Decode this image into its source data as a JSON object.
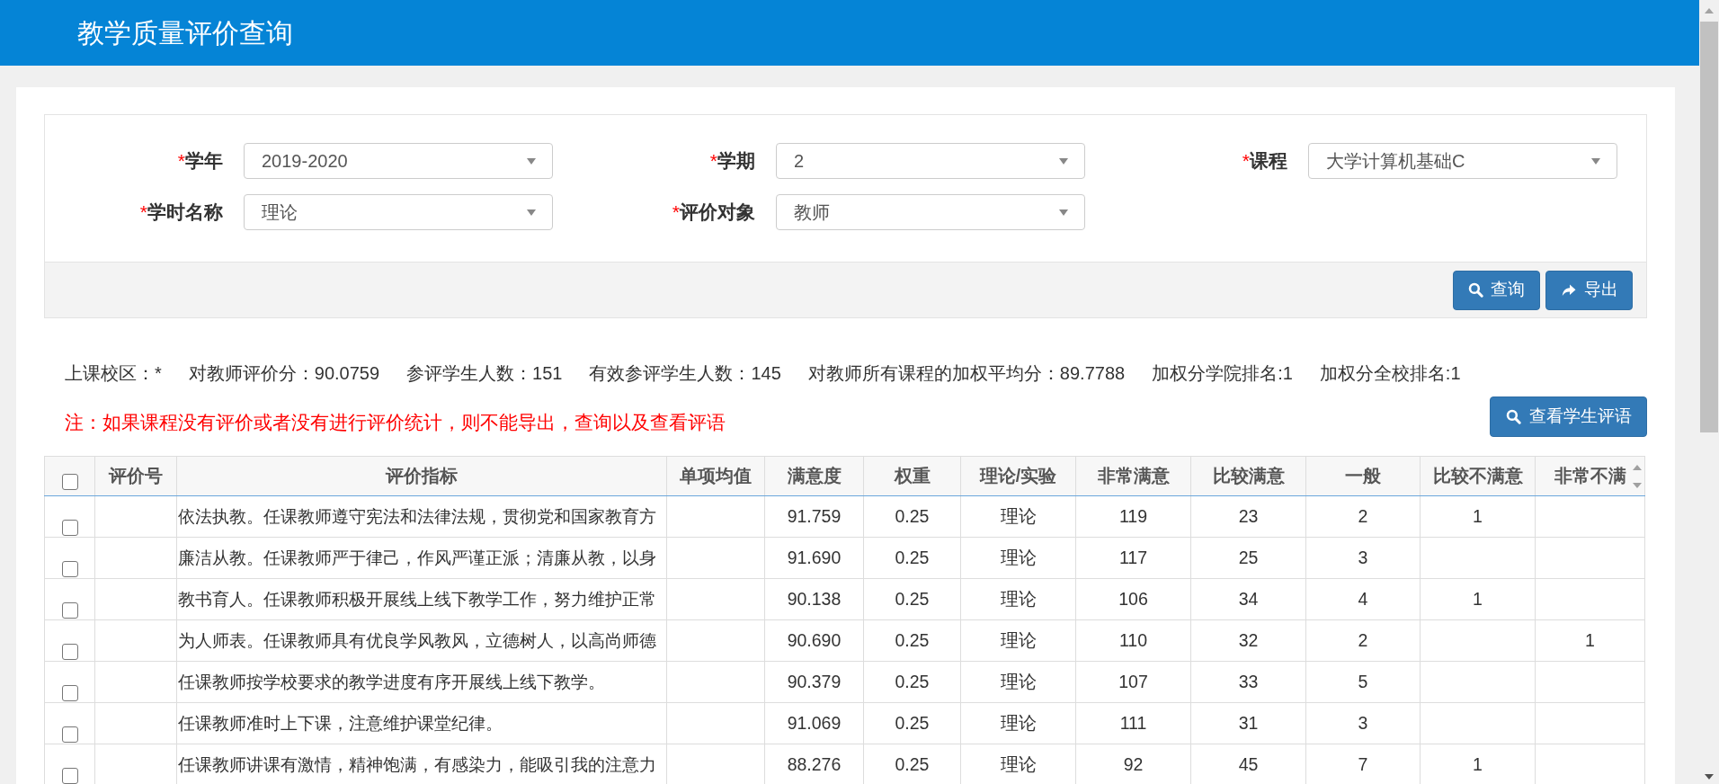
{
  "page": {
    "title": "教学质量评价查询"
  },
  "filters": [
    {
      "marker": "*",
      "label": "学年",
      "value": "2019-2020"
    },
    {
      "marker": "*",
      "label": "学期",
      "value": "2"
    },
    {
      "marker": "*",
      "label": "课程",
      "value": "大学计算机基础C"
    },
    {
      "marker": "*",
      "label": "学时名称",
      "value": "理论"
    },
    {
      "marker": "*",
      "label": "评价对象",
      "value": "教师"
    }
  ],
  "filter_buttons": [
    {
      "kind": "search",
      "label": "查询"
    },
    {
      "kind": "export",
      "label": "导出"
    }
  ],
  "stats": [
    "上课校区：*",
    "对教师评价分：90.0759",
    "参评学生人数：151",
    "有效参评学生人数：145",
    "对教师所有课程的加权平均分：89.7788",
    "加权分学院排名:1",
    "加权分全校排名:1"
  ],
  "note": "注：如果课程没有评价或者没有进行评价统计，则不能导出，查询以及查看评语",
  "comments_button": {
    "kind": "search",
    "label": "查看学生评语"
  },
  "table": {
    "select_all": {
      "checked": false
    },
    "columns": [
      "评价号",
      "评价指标",
      "单项均值",
      "满意度",
      "权重",
      "理论/实验",
      "非常满意",
      "比较满意",
      "一般",
      "比较不满意",
      "非常不满"
    ],
    "rows": [
      {
        "checked": false,
        "cells": [
          null,
          "依法执教。任课教师遵守宪法和法律法规，贯彻党和国家教育方",
          null,
          "91.759",
          "0.25",
          "理论",
          "119",
          "23",
          "2",
          "1",
          null
        ]
      },
      {
        "checked": false,
        "cells": [
          null,
          "廉洁从教。任课教师严于律己，作风严谨正派；清廉从教，以身",
          null,
          "91.690",
          "0.25",
          "理论",
          "117",
          "25",
          "3",
          null,
          null
        ]
      },
      {
        "checked": false,
        "cells": [
          null,
          "教书育人。任课教师积极开展线上线下教学工作，努力维护正常",
          null,
          "90.138",
          "0.25",
          "理论",
          "106",
          "34",
          "4",
          "1",
          null
        ]
      },
      {
        "checked": false,
        "cells": [
          null,
          "为人师表。任课教师具有优良学风教风，立德树人，以高尚师德",
          null,
          "90.690",
          "0.25",
          "理论",
          "110",
          "32",
          "2",
          null,
          "1"
        ]
      },
      {
        "checked": false,
        "cells": [
          null,
          "任课教师按学校要求的教学进度有序开展线上线下教学。",
          null,
          "90.379",
          "0.25",
          "理论",
          "107",
          "33",
          "5",
          null,
          null
        ]
      },
      {
        "checked": false,
        "cells": [
          null,
          "任课教师准时上下课，注意维护课堂纪律。",
          null,
          "91.069",
          "0.25",
          "理论",
          "111",
          "31",
          "3",
          null,
          null
        ]
      },
      {
        "checked": false,
        "cells": [
          null,
          "任课教师讲课有激情，精神饱满，有感染力，能吸引我的注意力",
          null,
          "88.276",
          "0.25",
          "理论",
          "92",
          "45",
          "7",
          "1",
          null
        ]
      }
    ]
  }
}
